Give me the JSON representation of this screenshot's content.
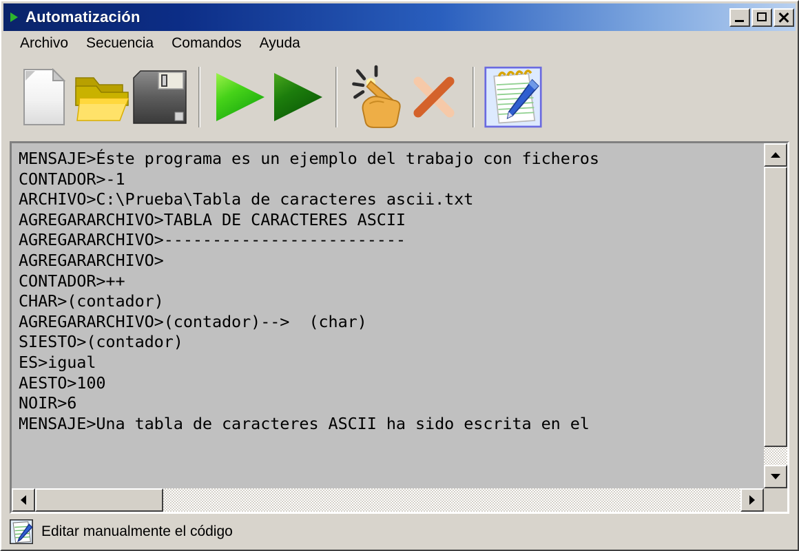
{
  "window": {
    "title": "Automatización",
    "title_icon": "green-play-triangle-icon",
    "controls": {
      "minimize_label": "_",
      "maximize_label": "□",
      "close_label": "✕"
    },
    "accent_color": "#0a246a",
    "face_color": "#d4d0c8"
  },
  "menu": {
    "items": [
      {
        "label": "Archivo"
      },
      {
        "label": "Secuencia"
      },
      {
        "label": "Comandos"
      },
      {
        "label": "Ayuda"
      }
    ]
  },
  "toolbar": {
    "buttons": [
      {
        "name": "new-document-button",
        "icon": "new-document-icon"
      },
      {
        "name": "open-folder-button",
        "icon": "open-folder-icon"
      },
      {
        "name": "save-button",
        "icon": "floppy-disk-save-icon"
      },
      {
        "name": "run-button",
        "icon": "green-play-light-icon"
      },
      {
        "name": "run-step-button",
        "icon": "green-play-dark-icon"
      },
      {
        "name": "wizard-button",
        "icon": "hand-magic-wand-icon"
      },
      {
        "name": "delete-button",
        "icon": "orange-x-delete-icon"
      },
      {
        "name": "edit-code-button",
        "icon": "notepad-pen-edit-icon",
        "selected": true
      }
    ]
  },
  "editor": {
    "lines": [
      "MENSAJE>Éste programa es un ejemplo del trabajo con ficheros",
      "CONTADOR>-1",
      "ARCHIVO>C:\\Prueba\\Tabla de caracteres ascii.txt",
      "AGREGARARCHIVO>TABLA DE CARACTERES ASCII",
      "AGREGARARCHIVO>-------------------------",
      "AGREGARARCHIVO>",
      "CONTADOR>++",
      "CHAR>(contador)",
      "AGREGARARCHIVO>(contador)-->  (char)",
      "SIESTO>(contador)",
      "ES>igual",
      "AESTO>100",
      "NOIR>6",
      "MENSAJE>Una tabla de caracteres ASCII ha sido escrita en el"
    ],
    "background_color": "#c0c0c0",
    "text_color": "#000000"
  },
  "scrollbars": {
    "vertical": {
      "up_arrow": "scroll-up-arrow",
      "down_arrow": "scroll-down-arrow"
    },
    "horizontal": {
      "left_arrow": "scroll-left-arrow",
      "right_arrow": "scroll-right-arrow"
    }
  },
  "status": {
    "icon": "notepad-pen-edit-icon",
    "text": "Editar manualmente el código"
  }
}
